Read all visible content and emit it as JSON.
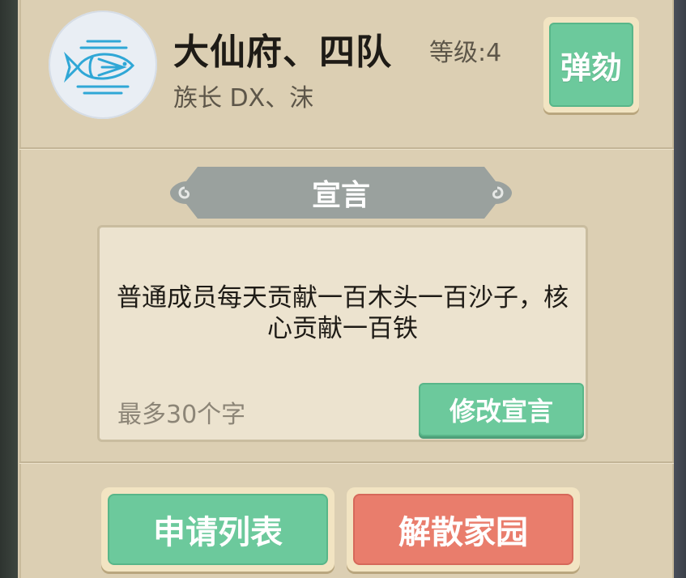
{
  "clan": {
    "name": "大仙府、四队",
    "level": "等级:4",
    "leader": "族长  DX、沫",
    "emblem_icon": "fish-icon"
  },
  "actions": {
    "impeach_label": "弹劾",
    "apply_list_label": "申请列表",
    "dismiss_label": "解散家园"
  },
  "declaration": {
    "title": "宣言",
    "text": "普通成员每天贡献一百木头一百沙子，核心贡献一百铁",
    "hint": "最多30个字",
    "edit_label": "修改宣言"
  },
  "colors": {
    "panel": "#dccfb3",
    "green_button": "#6cc99c",
    "red_button": "#e97d6c",
    "banner": "#9aa19e"
  }
}
